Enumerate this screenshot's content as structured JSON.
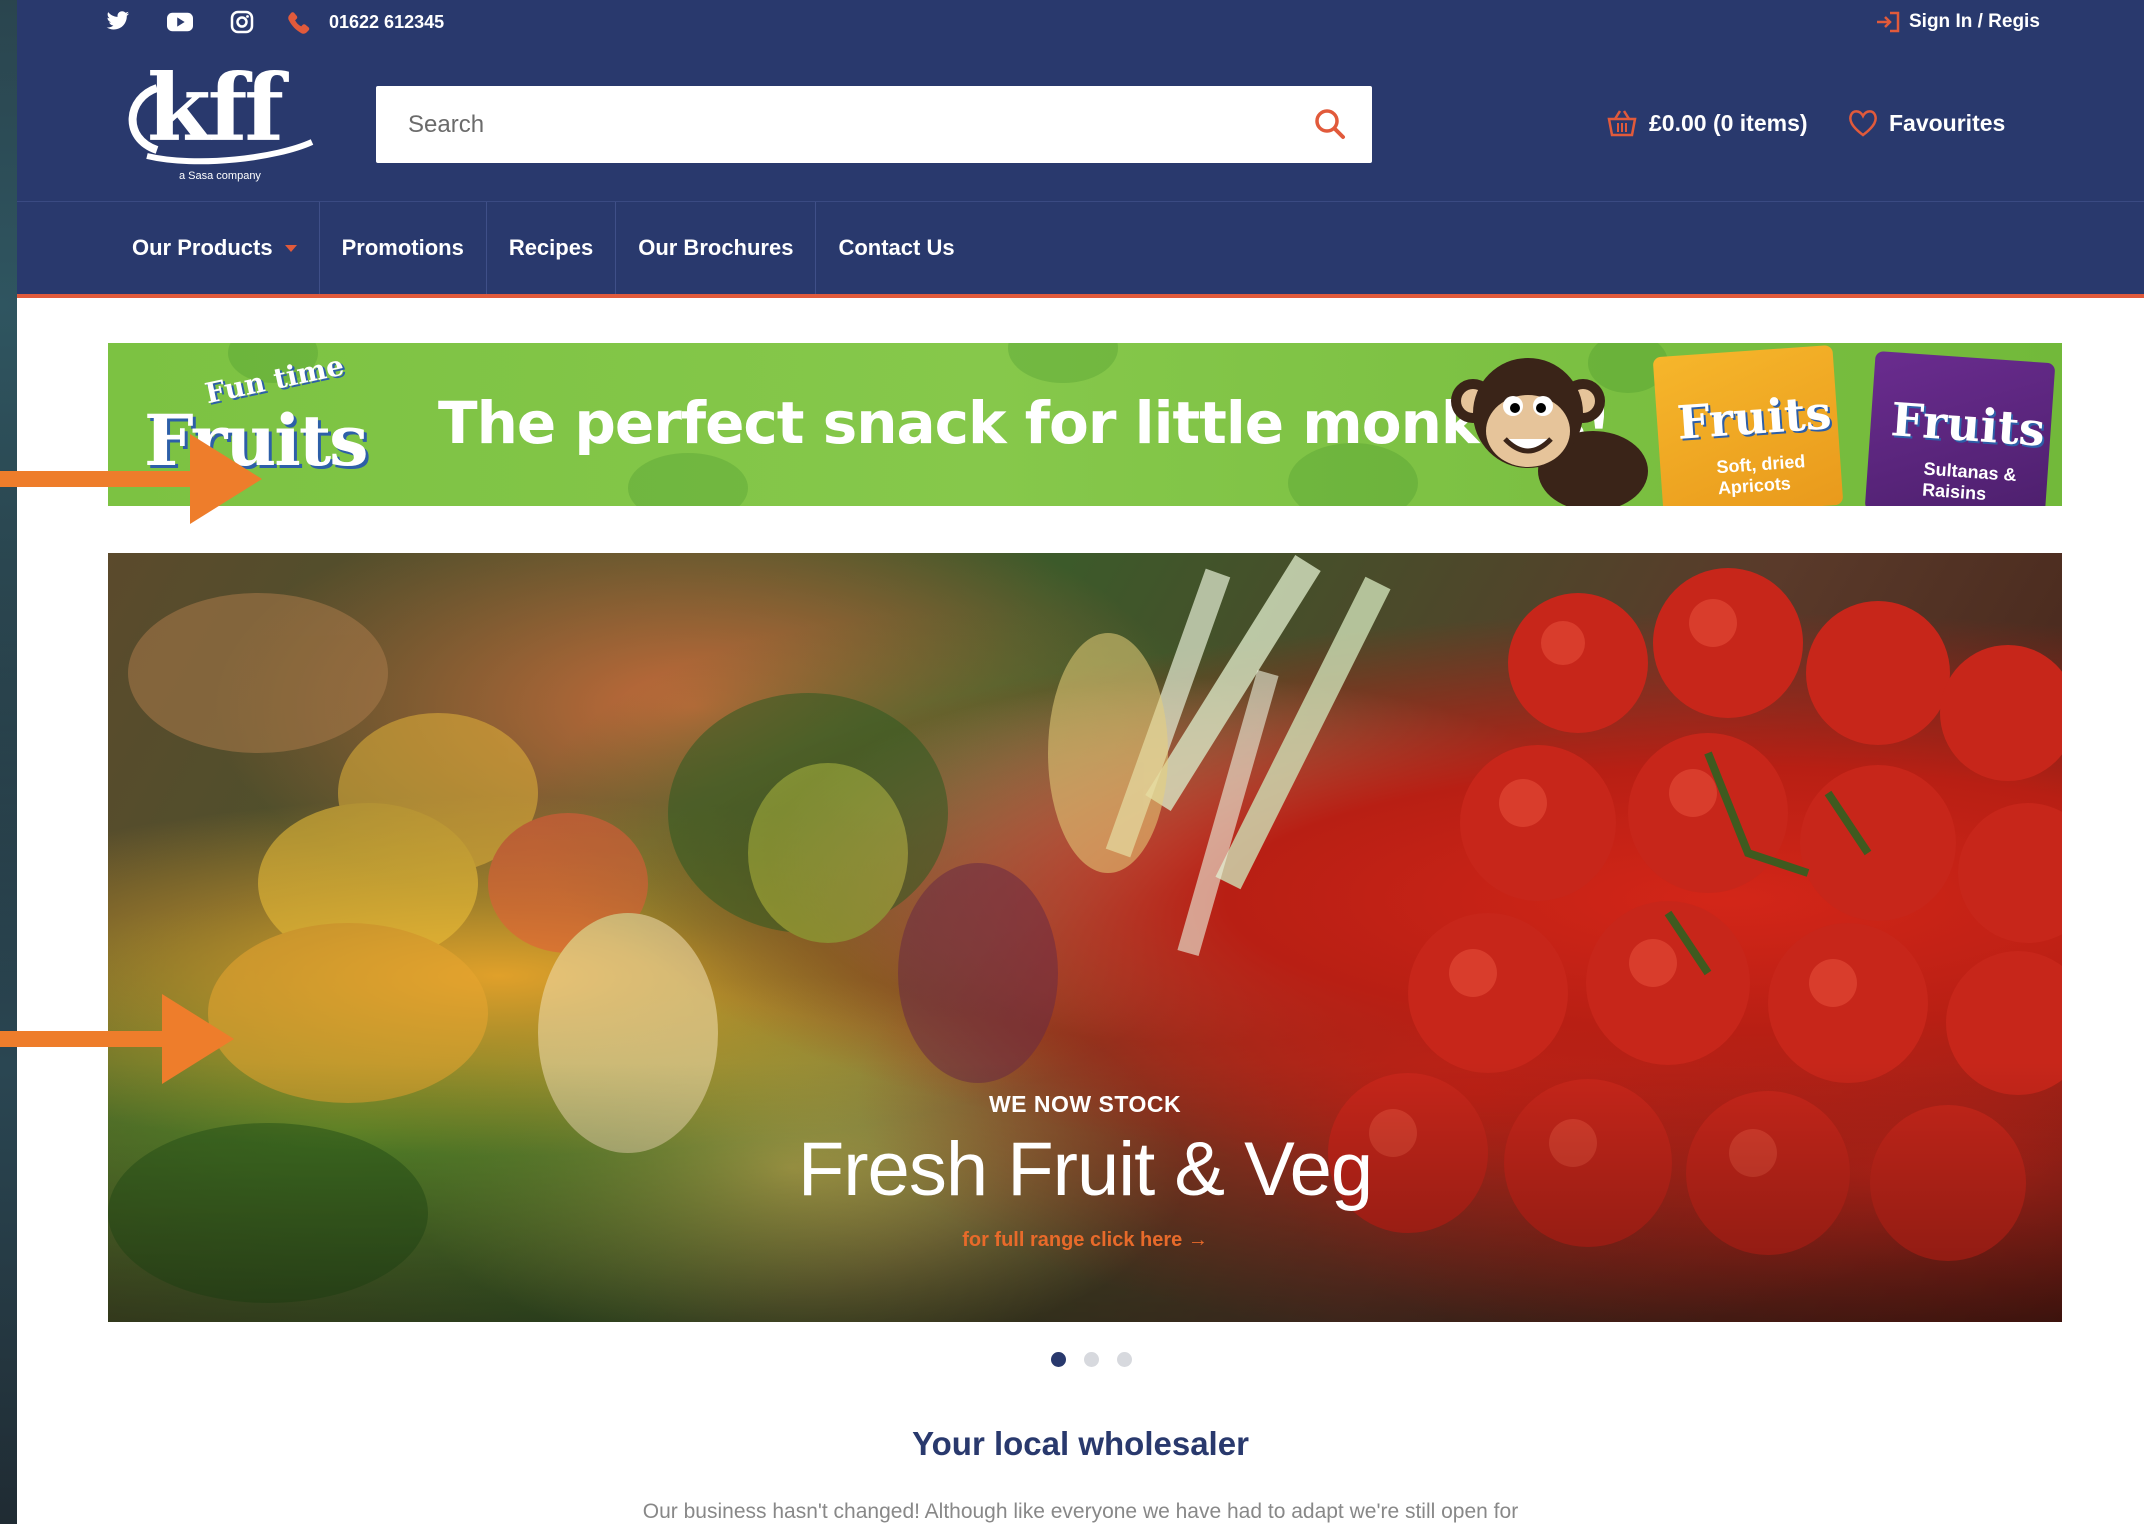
{
  "topbar": {
    "phone": "01622 612345",
    "signin_label": "Sign In / Regis"
  },
  "header": {
    "logo_text": "kff",
    "logo_tagline": "a Sasa company",
    "search_placeholder": "Search",
    "cart_label": "£0.00 (0 items)",
    "favourites_label": "Favourites"
  },
  "nav": {
    "items": [
      "Our Products",
      "Promotions",
      "Recipes",
      "Our Brochures",
      "Contact Us"
    ]
  },
  "banner": {
    "logo_small": "Fun time",
    "logo_big": "Fruits",
    "tagline": "The perfect snack for little monkeys!",
    "pack1_title": "Fruits",
    "pack1_sub": "Soft, dried Apricots",
    "pack2_title": "Fruits",
    "pack2_sub": "Sultanas & Raisins"
  },
  "hero": {
    "kicker": "WE NOW STOCK",
    "title": "Fresh Fruit & Veg",
    "link": "for full range click here →"
  },
  "carousel": {
    "active": 1,
    "total": 3
  },
  "intro": {
    "title": "Your local wholesaler",
    "body": "Our business hasn't changed! Although like everyone we have had to adapt we're still open for"
  },
  "colors": {
    "navy": "#29396d",
    "accent_orange": "#ee7d2b",
    "banner_green": "#7cc242"
  }
}
